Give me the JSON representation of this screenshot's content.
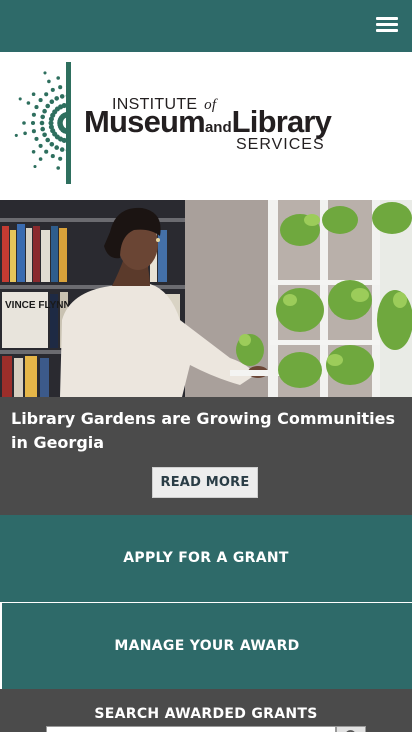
{
  "header": {
    "menu_icon": "hamburger-menu-icon"
  },
  "logo": {
    "line1": "INSTITUTE",
    "line1_of": "of",
    "line2_museum": "Museum",
    "line2_and": "and",
    "line2_library": "Library",
    "line3": "SERVICES",
    "colors": {
      "dots": "#2e6f5e",
      "text": "#231f20"
    }
  },
  "hero": {
    "book_spine_text": "VINCE FLYNN"
  },
  "feature": {
    "title": "Library Gardens are Growing Communities in Georgia",
    "read_more_label": "READ MORE"
  },
  "actions": {
    "apply_label": "APPLY FOR A GRANT",
    "manage_label": "MANAGE YOUR AWARD"
  },
  "search": {
    "label": "SEARCH AWARDED GRANTS",
    "placeholder": "",
    "button_icon": "search-icon"
  },
  "colors": {
    "teal": "#2e6a69",
    "dark_gray": "#4b4b4b",
    "button_bg": "#ededed"
  }
}
